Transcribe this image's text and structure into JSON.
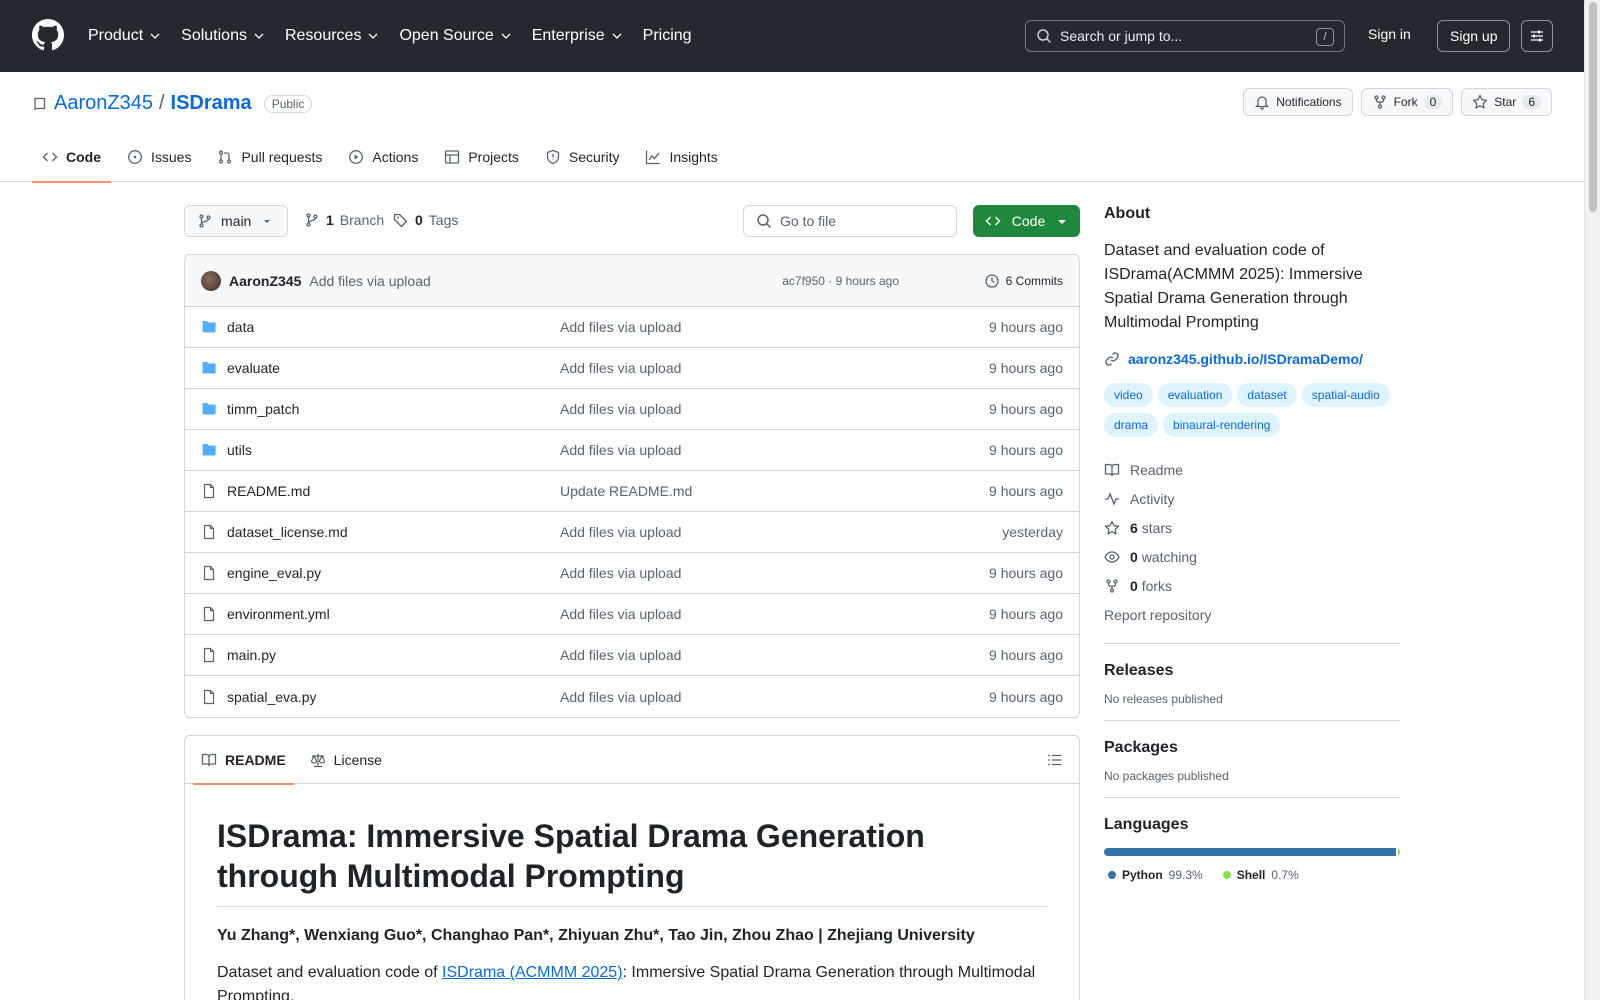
{
  "header": {
    "nav": [
      "Product",
      "Solutions",
      "Resources",
      "Open Source",
      "Enterprise",
      "Pricing"
    ],
    "search_placeholder": "Search or jump to...",
    "search_key": "/",
    "signin": "Sign in",
    "signup": "Sign up"
  },
  "repo": {
    "owner": "AaronZ345",
    "separator": "/",
    "name": "ISDrama",
    "visibility": "Public",
    "notifications": "Notifications",
    "fork_label": "Fork",
    "fork_count": "0",
    "star_label": "Star",
    "star_count": "6"
  },
  "tabs": [
    "Code",
    "Issues",
    "Pull requests",
    "Actions",
    "Projects",
    "Security",
    "Insights"
  ],
  "toolbar": {
    "branch": "main",
    "branch_count": "1",
    "branch_label": "Branch",
    "tag_count": "0",
    "tag_label": "Tags",
    "goto_placeholder": "Go to file",
    "code_label": "Code"
  },
  "commit": {
    "author": "AaronZ345",
    "message": "Add files via upload",
    "meta": "ac7f950 · 9 hours ago",
    "count": "6 Commits"
  },
  "files": [
    {
      "name": "data",
      "type": "dir",
      "message": "Add files via upload",
      "time": "9 hours ago"
    },
    {
      "name": "evaluate",
      "type": "dir",
      "message": "Add files via upload",
      "time": "9 hours ago"
    },
    {
      "name": "timm_patch",
      "type": "dir",
      "message": "Add files via upload",
      "time": "9 hours ago"
    },
    {
      "name": "utils",
      "type": "dir",
      "message": "Add files via upload",
      "time": "9 hours ago"
    },
    {
      "name": "README.md",
      "type": "file",
      "message": "Update README.md",
      "time": "9 hours ago"
    },
    {
      "name": "dataset_license.md",
      "type": "file",
      "message": "Add files via upload",
      "time": "yesterday"
    },
    {
      "name": "engine_eval.py",
      "type": "file",
      "message": "Add files via upload",
      "time": "9 hours ago"
    },
    {
      "name": "environment.yml",
      "type": "file",
      "message": "Add files via upload",
      "time": "9 hours ago"
    },
    {
      "name": "main.py",
      "type": "file",
      "message": "Add files via upload",
      "time": "9 hours ago"
    },
    {
      "name": "spatial_eva.py",
      "type": "file",
      "message": "Add files via upload",
      "time": "9 hours ago"
    }
  ],
  "readme": {
    "tab_readme": "README",
    "tab_license": "License",
    "title": "ISDrama: Immersive Spatial Drama Generation through Multimodal Prompting",
    "authors": "Yu Zhang*, Wenxiang Guo*, Changhao Pan*, Zhiyuan Zhu*, Tao Jin, Zhou Zhao | Zhejiang University",
    "p_before": "Dataset and evaluation code of ",
    "p_link": "ISDrama (ACMMM 2025)",
    "p_after": ": Immersive Spatial Drama Generation through Multimodal Prompting."
  },
  "about": {
    "heading": "About",
    "description": "Dataset and evaluation code of ISDrama(ACMMM 2025): Immersive Spatial Drama Generation through Multimodal Prompting",
    "link": "aaronz345.github.io/ISDramaDemo/",
    "topics": [
      "video",
      "evaluation",
      "dataset",
      "spatial-audio",
      "drama",
      "binaural-rendering"
    ],
    "readme": "Readme",
    "activity": "Activity",
    "stars_count": "6",
    "stars_label": "stars",
    "watching_count": "0",
    "watching_label": "watching",
    "forks_count": "0",
    "forks_label": "forks",
    "report": "Report repository"
  },
  "releases": {
    "heading": "Releases",
    "text": "No releases published"
  },
  "packages": {
    "heading": "Packages",
    "text": "No packages published"
  },
  "languages": {
    "heading": "Languages",
    "items": [
      {
        "name": "Python",
        "percent": "99.3%",
        "value": 99.3,
        "color": "#3572A5"
      },
      {
        "name": "Shell",
        "percent": "0.7%",
        "value": 0.7,
        "color": "#89e051"
      }
    ]
  }
}
